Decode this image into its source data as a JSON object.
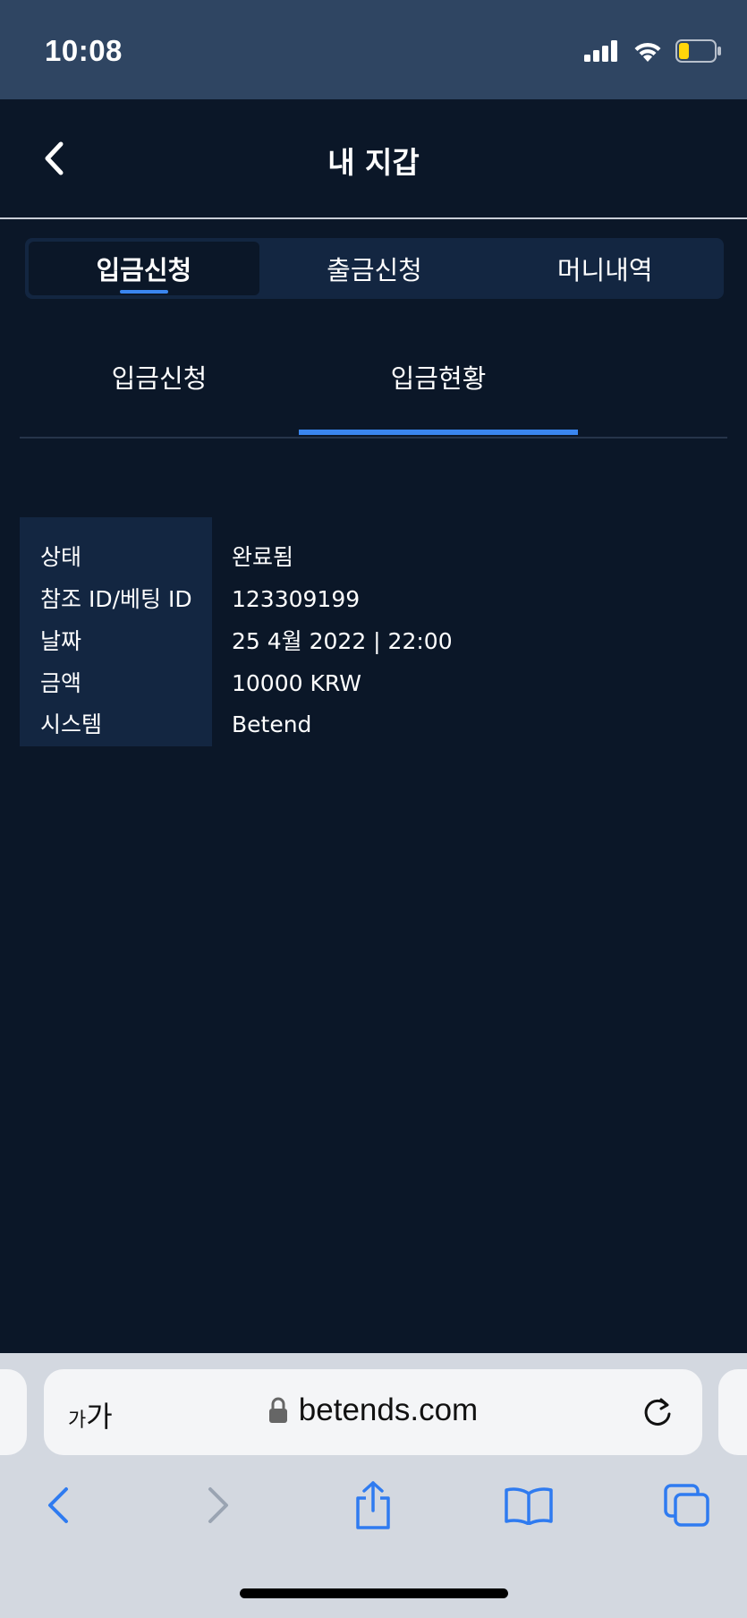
{
  "status_bar": {
    "time": "10:08",
    "icons": [
      "cellular-signal-icon",
      "wifi-icon",
      "battery-low-icon"
    ]
  },
  "header": {
    "title": "내 지갑",
    "back_icon": "chevron-left-icon"
  },
  "main_tabs": [
    {
      "label": "입금신청",
      "active": true
    },
    {
      "label": "출금신청",
      "active": false
    },
    {
      "label": "머니내역",
      "active": false
    }
  ],
  "sub_tabs": [
    {
      "label": "입금신청",
      "active": false
    },
    {
      "label": "입금현황",
      "active": true
    }
  ],
  "details": {
    "status": {
      "label": "상태",
      "value": "완료됨"
    },
    "reference": {
      "label": "참조 ID/베팅 ID",
      "value": "123309199"
    },
    "date": {
      "label": "날짜",
      "value": "25 4월 2022 | 22:00"
    },
    "amount": {
      "label": "금액",
      "value": "10000 KRW"
    },
    "system": {
      "label": "시스템",
      "value": "Betend"
    }
  },
  "browser": {
    "text_size_label_small": "가",
    "text_size_label_large": "가",
    "url": "betends.com",
    "icons": [
      "lock-icon",
      "reload-icon",
      "back-arrow-icon",
      "forward-arrow-icon",
      "share-icon",
      "bookmarks-icon",
      "tabs-icon"
    ]
  },
  "colors": {
    "background": "#0b1728",
    "status_bar": "#2f4562",
    "panel": "#132641",
    "accent": "#3a86f0",
    "browser_bar": "#d3d8e0",
    "browser_icon": "#2f7bf0"
  }
}
